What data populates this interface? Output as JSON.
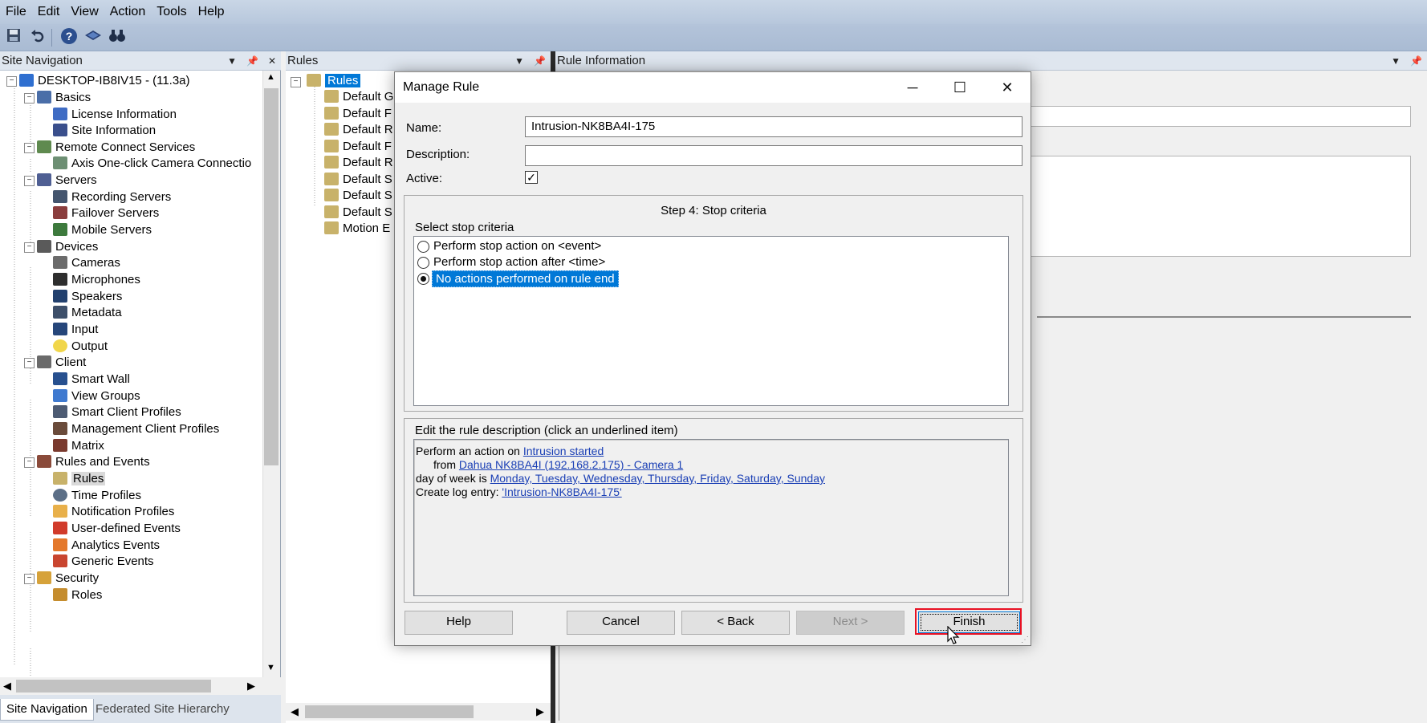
{
  "menu": [
    "File",
    "Edit",
    "View",
    "Action",
    "Tools",
    "Help"
  ],
  "toolbar": {
    "icons": [
      "save-icon",
      "undo-icon",
      "help-icon",
      "connect-icon",
      "find-icon"
    ]
  },
  "panes": {
    "site_navigation_title": "Site Navigation",
    "rules_title": "Rules",
    "rule_information_title": "Rule Information"
  },
  "site_tree": {
    "root": "DESKTOP-IB8IV15 - (11.3a)",
    "basics": "Basics",
    "license_information": "License Information",
    "site_information": "Site Information",
    "remote_connect_services": "Remote Connect Services",
    "axis_one_click": "Axis One-click Camera Connectio",
    "servers": "Servers",
    "recording_servers": "Recording Servers",
    "failover_servers": "Failover Servers",
    "mobile_servers": "Mobile Servers",
    "devices": "Devices",
    "cameras": "Cameras",
    "microphones": "Microphones",
    "speakers": "Speakers",
    "metadata": "Metadata",
    "input": "Input",
    "output": "Output",
    "client": "Client",
    "smart_wall": "Smart Wall",
    "view_groups": "View Groups",
    "smart_client_profiles": "Smart Client Profiles",
    "management_client_profiles": "Management Client Profiles",
    "matrix": "Matrix",
    "rules_and_events": "Rules and Events",
    "rules": "Rules",
    "time_profiles": "Time Profiles",
    "notification_profiles": "Notification Profiles",
    "user_defined_events": "User-defined Events",
    "analytics_events": "Analytics Events",
    "generic_events": "Generic Events",
    "security": "Security",
    "roles": "Roles"
  },
  "nav_tabs": {
    "site_navigation": "Site Navigation",
    "federated": "Federated Site Hierarchy"
  },
  "rules_tree": {
    "root": "Rules",
    "items": [
      "Default G",
      "Default F",
      "Default R",
      "Default F",
      "Default R",
      "Default S",
      "Default S",
      "Default S",
      "Motion E"
    ]
  },
  "dialog": {
    "title": "Manage Rule",
    "name_label": "Name:",
    "name_value": "Intrusion-NK8BA4I-175",
    "description_label": "Description:",
    "description_value": "",
    "active_label": "Active:",
    "active_checked": true,
    "step_title": "Step 4: Stop criteria",
    "select_label": "Select stop criteria",
    "options": [
      "Perform stop action on <event>",
      "Perform stop action after <time>",
      "No actions performed on rule end"
    ],
    "selected_option": 2,
    "edit_label": "Edit the rule description (click an underlined item)",
    "desc": {
      "line1_prefix": "Perform an action on ",
      "line1_link": "Intrusion started",
      "line2_prefix": "from ",
      "line2_link": "Dahua NK8BA4I (192.168.2.175) - Camera 1",
      "line3_prefix": "day of week is ",
      "line3_link": "Monday, Tuesday, Wednesday, Thursday, Friday, Saturday, Sunday",
      "line4_prefix": "Create log entry: ",
      "line4_link": "'Intrusion-NK8BA4I-175'"
    },
    "buttons": {
      "help": "Help",
      "cancel": "Cancel",
      "back": "< Back",
      "next": "Next >",
      "finish": "Finish"
    },
    "highlight_color": "#0078d7",
    "finish_outline_color": "#e81123"
  }
}
